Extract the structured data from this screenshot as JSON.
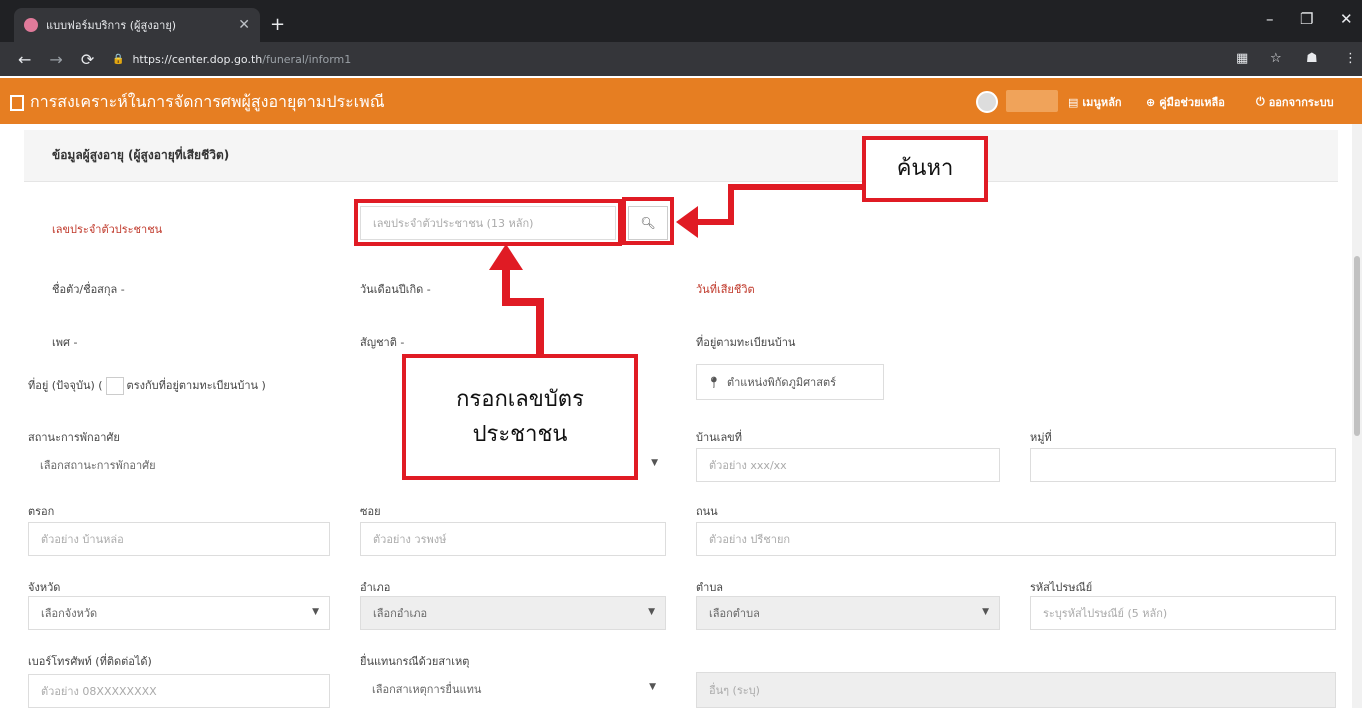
{
  "browser": {
    "tab_title": "แบบฟอร์มบริการ (ผู้สูงอายุ)",
    "tab_close": "✕",
    "new_tab": "+",
    "url_host": "https://center.dop.go.th",
    "url_path": "/funeral/inform1",
    "win_min": "–",
    "win_max": "❐",
    "win_close": "✕"
  },
  "app": {
    "title": "การสงเคราะห์ในการจัดการศพผู้สูงอายุตามประเพณี",
    "nav": {
      "home": "เมนูหลัก",
      "manual": "คู่มือช่วยเหลือ",
      "logout": "ออกจากระบบ"
    }
  },
  "section": {
    "title": "ข้อมูลผู้สูงอายุ (ผู้สูงอายุที่เสียชีวิต)"
  },
  "form": {
    "id_label": "เลขประจำตัวประชาชน",
    "id_placeholder": "เลขประจำตัวประชาชน (13 หลัก)",
    "name_label": "ชื่อตัว/ชื่อสกุล -",
    "dob_label": "วันเดือนปีเกิด -",
    "death_label": "วันที่เสียชีวิต",
    "sex_label": "เพศ -",
    "nationality_label": "สัญชาติ -",
    "reg_address_label": "ที่อยู่ตามทะเบียนบ้าน",
    "cur_address_prefix": "ที่อยู่ (ปัจจุบัน) (",
    "cur_address_same": "ตรงกับที่อยู่ตามทะเบียนบ้าน )",
    "map_button": "ตำแหน่งพิกัดภูมิศาสตร์",
    "residence_label": "สถานะการพักอาศัย",
    "residence_value": "เลือกสถานะการพักอาศัย",
    "house_no_label": "บ้านเลขที่",
    "house_no_placeholder": "ตัวอย่าง xxx/xx",
    "moo_label": "หมู่ที่",
    "trok_label": "ตรอก",
    "trok_placeholder": "ตัวอย่าง บ้านหล่อ",
    "soi_label": "ซอย",
    "soi_placeholder": "ตัวอย่าง วรพงษ์",
    "road_label": "ถนน",
    "road_placeholder": "ตัวอย่าง ปรีชายก",
    "province_label": "จังหวัด",
    "province_value": "เลือกจังหวัด",
    "district_label": "อำเภอ",
    "district_value": "เลือกอำเภอ",
    "subdistrict_label": "ตำบล",
    "subdistrict_value": "เลือกตำบล",
    "postcode_label": "รหัสไปรษณีย์",
    "postcode_placeholder": "ระบุรหัสไปรษณีย์ (5 หลัก)",
    "phone_label": "เบอร์โทรศัพท์ (ที่ติดต่อได้)",
    "phone_placeholder": "ตัวอย่าง 08XXXXXXXX",
    "reason_label": "ยื่นแทนกรณีด้วยสาเหตุ",
    "reason_value": "เลือกสาเหตุการยื่นแทน",
    "other_placeholder": "อื่นๆ (ระบุ)"
  },
  "annotations": {
    "search": "ค้นหา",
    "fill_id_line1": "กรอกเลขบัตร",
    "fill_id_line2": "ประชาชน"
  },
  "colors": {
    "appbar": "#e67e22",
    "annotation": "#e01b24",
    "required_label": "#c0392b"
  }
}
